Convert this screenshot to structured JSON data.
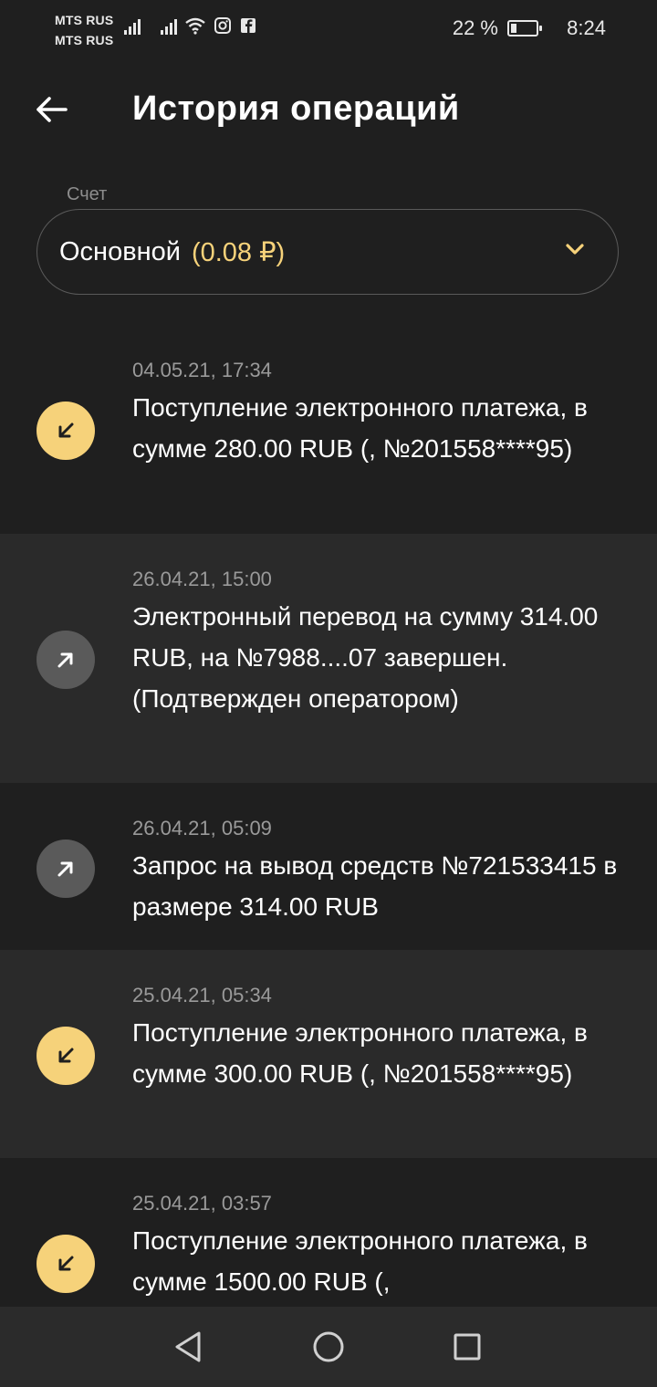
{
  "status_bar": {
    "carrier_1": "MTS RUS",
    "carrier_2": "MTS RUS",
    "battery_percent_text": "22 %",
    "battery_level": 0.22,
    "time": "8:24"
  },
  "header": {
    "title": "История операций",
    "back_icon": "arrow-left-icon"
  },
  "account": {
    "label": "Счет",
    "name": "Основной",
    "balance": "(0.08 ₽)",
    "chevron_icon": "chevron-down-icon"
  },
  "operations": [
    {
      "date": "04.05.21, 17:34",
      "description": "Поступление электронного платежа, в сумме 280.00 RUB (, №201558****95)",
      "direction": "incoming",
      "icon": "arrow-down-left-icon"
    },
    {
      "date": "26.04.21, 15:00",
      "description": "Электронный перевод на сумму 314.00 RUB, на №7988....07 завершен. (Подтвержден оператором)",
      "direction": "outgoing",
      "icon": "arrow-up-right-icon"
    },
    {
      "date": "26.04.21, 05:09",
      "description": "Запрос на вывод средств №721533415 в размере 314.00 RUB",
      "direction": "outgoing",
      "icon": "arrow-up-right-icon"
    },
    {
      "date": "25.04.21, 05:34",
      "description": "Поступление электронного платежа, в сумме 300.00 RUB (, №201558****95)",
      "direction": "incoming",
      "icon": "arrow-down-left-icon"
    },
    {
      "date": "25.04.21, 03:57",
      "description": "Поступление электронного платежа, в сумме 1500.00 RUB (,",
      "direction": "incoming",
      "icon": "arrow-down-left-icon"
    }
  ],
  "colors": {
    "accent": "#f6d27a",
    "background": "#1f1f1f",
    "row_alt": "#2a2a2a",
    "outgoing_badge": "#5a5a5a"
  }
}
